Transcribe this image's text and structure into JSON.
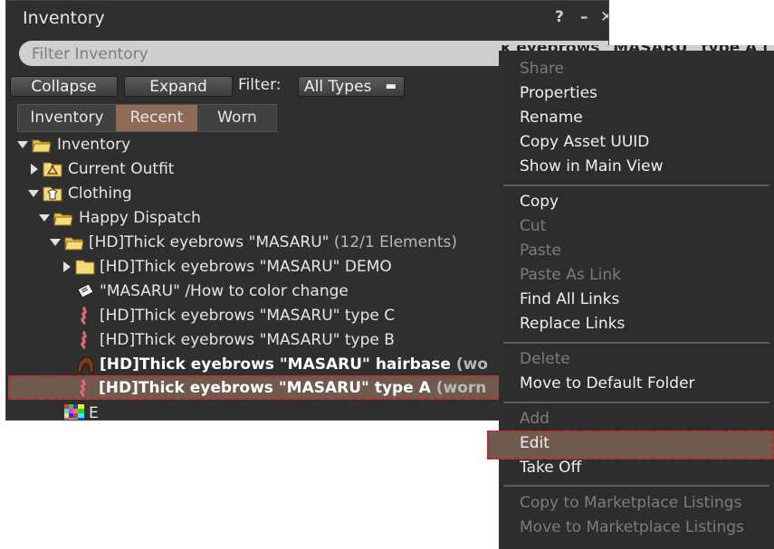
{
  "window": {
    "title": "Inventory",
    "help_label": "?",
    "minimize_label": "–",
    "close_label": "✕"
  },
  "search": {
    "placeholder": "Filter Inventory"
  },
  "toolbar": {
    "collapse_label": "Collapse",
    "expand_label": "Expand",
    "filter_label": "Filter:",
    "filter_value": "All Types"
  },
  "tabs": [
    {
      "label": "Inventory"
    },
    {
      "label": "Recent"
    },
    {
      "label": "Worn"
    }
  ],
  "tree": {
    "root": "Inventory",
    "current_outfit": "Current Outfit",
    "clothing": "Clothing",
    "happy_dispatch": "Happy Dispatch",
    "eyebrows_folder": "[HD]Thick eyebrows \"MASARU\"",
    "eyebrows_folder_count": "(12/1 Elements)",
    "demo_folder": "[HD]Thick eyebrows \"MASARU\" DEMO",
    "notecard": "\"MASARU\" /How to color change",
    "type_c": "[HD]Thick eyebrows \"MASARU\" type C",
    "type_b": "[HD]Thick eyebrows \"MASARU\" type B",
    "hairbase": "[HD]Thick eyebrows \"MASARU\" hairbase",
    "hairbase_suffix": "(wo",
    "type_a": "[HD]Thick eyebrows \"MASARU\" type A",
    "type_a_suffix": "(worn",
    "last_item": "E"
  },
  "peek_text": "k eyebrows \"MASARU\" type A (",
  "menu": {
    "share": "Share",
    "properties": "Properties",
    "rename": "Rename",
    "copy_uuid": "Copy Asset UUID",
    "show_main": "Show in Main View",
    "copy": "Copy",
    "cut": "Cut",
    "paste": "Paste",
    "paste_link": "Paste As Link",
    "find_links": "Find All Links",
    "replace_links": "Replace Links",
    "delete": "Delete",
    "move_default": "Move to Default Folder",
    "add": "Add",
    "edit": "Edit",
    "take_off": "Take Off",
    "copy_marketplace": "Copy to Marketplace Listings",
    "move_marketplace": "Move to Marketplace Listings"
  },
  "colors": {
    "panel_bg": "#2f2f2f",
    "selection": "#6f5a4d",
    "active_tab": "#8e6a58",
    "highlight_border": "#c22a2a"
  }
}
